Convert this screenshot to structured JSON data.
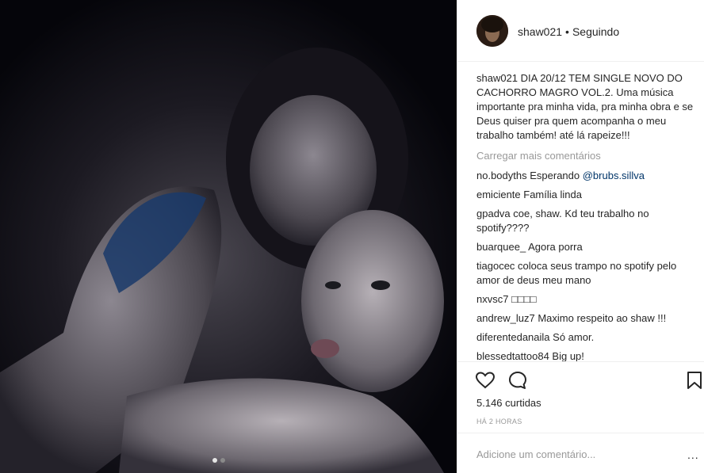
{
  "header": {
    "username": "shaw021",
    "separator": "•",
    "follow_status": "Seguindo"
  },
  "caption": {
    "username": "shaw021",
    "text": "DIA 20/12 TEM SINGLE NOVO DO CACHORRO MAGRO VOL.2. Uma música importante pra minha vida, pra minha obra e se Deus quiser pra quem acompanha o meu trabalho também! até lá rapeize!!!"
  },
  "load_more": "Carregar mais comentários",
  "comments": [
    {
      "username": "no.bodyths",
      "text": "Esperando ",
      "mention": "@brubs.sillva"
    },
    {
      "username": "emiciente",
      "text": "Família linda"
    },
    {
      "username": "gpadva",
      "text": "coe, shaw. Kd teu trabalho no spotify????"
    },
    {
      "username": "buarquee_",
      "text": "Agora porra"
    },
    {
      "username": "tiagocec",
      "text": "coloca seus trampo no spotify pelo amor de deus meu mano"
    },
    {
      "username": "nxvsc7",
      "text": "□□□□"
    },
    {
      "username": "andrew_luz7",
      "text": "Maximo respeito ao shaw !!!"
    },
    {
      "username": "diferentedanaila",
      "text": "Só amor."
    },
    {
      "username": "blessedtattoo84",
      "text": "Big up!"
    }
  ],
  "actions": {
    "like_icon": "heart-icon",
    "comment_icon": "comment-bubble-icon",
    "save_icon": "bookmark-icon",
    "likes": "5.146 curtidas",
    "time": "HÁ 2 HORAS"
  },
  "add_comment": {
    "placeholder": "Adicione um comentário...",
    "more": "..."
  },
  "carousel": {
    "total": 2,
    "active": 1
  }
}
